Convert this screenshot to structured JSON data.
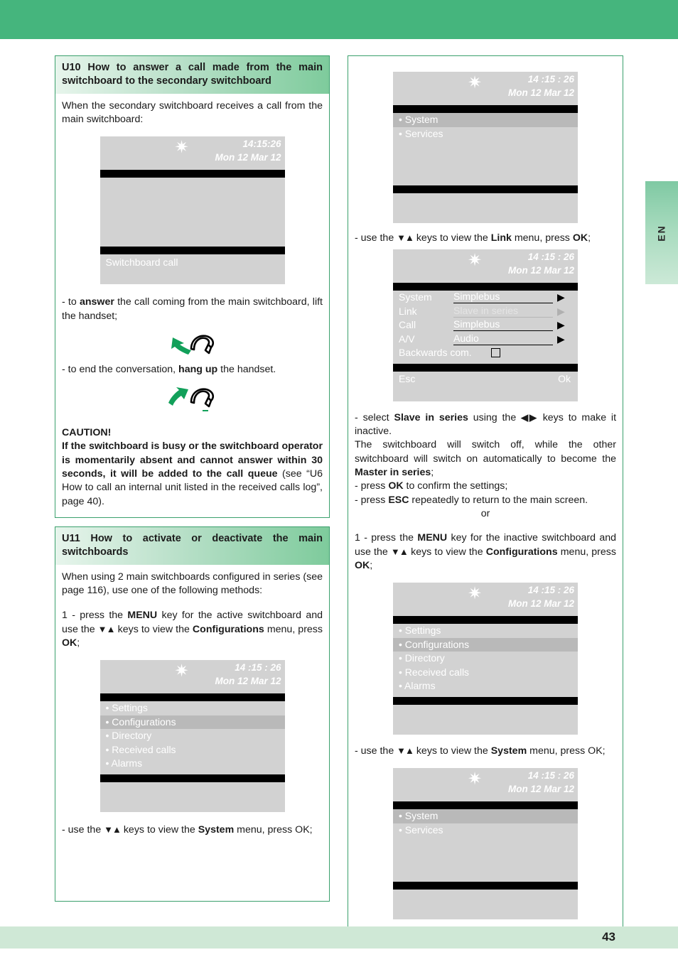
{
  "page": {
    "number": "43",
    "language_tab": "EN",
    "accent_green": "#45b57d",
    "heading_green": "#7ecb9c",
    "footer_green": "#cfe8d6"
  },
  "left_column": {
    "section_u10": {
      "heading": "U10 How to answer a call made from the main switchboard to the secondary switchboard",
      "intro": "When the secondary switchboard receives a call from the main switchboard:",
      "screen": {
        "star_icon": "star-icon",
        "time": "14:15:26",
        "date": "Mon 12 Mar 12",
        "status": "Switchboard call"
      },
      "para_answer_pre": "- to ",
      "para_answer_bold": "answer",
      "para_answer_post": " the call coming from the main switchboard, lift the handset;",
      "icon_lift": "handset-lift-icon",
      "para_hangup_pre": "- to end the conversation, ",
      "para_hangup_bold": "hang up",
      "para_hangup_post": " the handset.",
      "icon_hangup": "handset-hangup-icon",
      "caution_title": "CAUTION!",
      "caution_bold_1": "If the switchboard is busy or the switchboard operator is momentarily absent and cannot answer within 30 seconds, it will be added to the call queue",
      "caution_rest": " (see “U6 How to call an internal unit listed in the received calls log”, page 40)."
    },
    "section_u11": {
      "heading": "U11 How to activate or deactivate the main switchboards",
      "intro": "When using 2 main switchboards configured in series (see page 116), use one of the following methods:",
      "step1_a": "1 - press the ",
      "step1_menu": "MENU",
      "step1_b": " key for the active switchboard and use the ",
      "step1_arrows": "▼▲",
      "step1_c": " keys to view the ",
      "step1_config": "Configurations",
      "step1_d": " menu, press ",
      "step1_ok": "OK",
      "step1_e": ";",
      "screen_menu": {
        "star_icon": "star-icon",
        "time": "14 :15 : 26",
        "date": "Mon 12 Mar 12",
        "items": [
          {
            "label": "• Settings",
            "selected": false
          },
          {
            "label": "• Configurations",
            "selected": true
          },
          {
            "label": "• Directory",
            "selected": false
          },
          {
            "label": "• Received calls",
            "selected": false
          },
          {
            "label": "• Alarms",
            "selected": false
          }
        ]
      },
      "step2_a": "  -  use the ",
      "step2_arrows": "▼▲",
      "step2_b": " keys to view the ",
      "step2_system": "System",
      "step2_c": " menu, press OK;"
    }
  },
  "right_column": {
    "screen_system_top": {
      "star_icon": "star-icon",
      "time": "14 :15 : 26",
      "date": "Mon 12 Mar 12",
      "items": [
        {
          "label": "• System",
          "selected": true
        },
        {
          "label": "• Services",
          "selected": false
        }
      ]
    },
    "link_step_a": "- use the ",
    "link_step_arrows": "▼▲",
    "link_step_b": " keys to view the ",
    "link_step_link": "Link",
    "link_step_c": " menu, press ",
    "link_step_ok": "OK",
    "link_step_d": ";",
    "screen_link": {
      "star_icon": "star-icon",
      "time": "14 :15 : 26",
      "date": "Mon 12 Mar 12",
      "rows": [
        {
          "label": "System",
          "value": "Simplebus",
          "type": "arrow",
          "inactive": false
        },
        {
          "label": "Link",
          "value": "Slave in series",
          "type": "arrow",
          "inactive": true
        },
        {
          "label": "Call",
          "value": "Simplebus",
          "type": "arrow",
          "inactive": false
        },
        {
          "label": "A/V",
          "value": "Audio",
          "type": "arrow",
          "inactive": false
        },
        {
          "label": "Backwards com.",
          "value": "",
          "type": "checkbox",
          "inactive": false
        }
      ],
      "esc_label": "Esc",
      "ok_label": "Ok"
    },
    "select_a": "- select ",
    "select_bold": "Slave in series",
    "select_b": " using the ",
    "select_arrows": "◀▶",
    "select_c": " keys to make it inactive.",
    "para_switch_a": "The switchboard will switch off, while the other switchboard will switch on automatically to become the ",
    "para_switch_master": "Master in series",
    "para_switch_b": ";",
    "para_ok_a": "- press ",
    "para_ok_bold": "OK",
    "para_ok_b": " to confirm the settings;",
    "para_esc_a": "- press ",
    "para_esc_bold": "ESC",
    "para_esc_b": " repeatedly to return to the main screen.",
    "or_label": "or",
    "step1_a": "1 - press the ",
    "step1_menu": "MENU",
    "step1_b": " key for the inactive switchboard and use the ",
    "step1_arrows": "▼▲",
    "step1_c": " keys to view the ",
    "step1_config": "Configurations",
    "step1_d": " menu, press ",
    "step1_ok": "OK",
    "step1_e": ";",
    "screen_menu": {
      "star_icon": "star-icon",
      "time": "14 :15 : 26",
      "date": "Mon 12 Mar 12",
      "items": [
        {
          "label": "• Settings",
          "selected": false
        },
        {
          "label": "• Configurations",
          "selected": true
        },
        {
          "label": "• Directory",
          "selected": false
        },
        {
          "label": "• Received calls",
          "selected": false
        },
        {
          "label": "• Alarms",
          "selected": false
        }
      ]
    },
    "step2_a": " - use the ",
    "step2_arrows": "▼▲",
    "step2_b": " keys to view the ",
    "step2_system": "System",
    "step2_c": " menu, press OK;",
    "screen_system_bottom": {
      "star_icon": "star-icon",
      "time": "14 :15 : 26",
      "date": "Mon 12 Mar 12",
      "items": [
        {
          "label": "• System",
          "selected": true
        },
        {
          "label": "• Services",
          "selected": false
        }
      ]
    }
  }
}
